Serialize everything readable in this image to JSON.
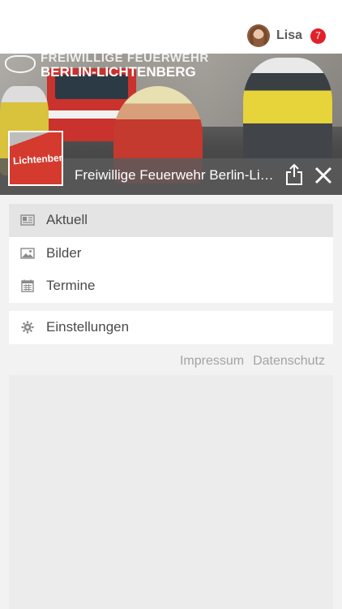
{
  "user": {
    "name": "Lisa",
    "notifications": "7"
  },
  "hero": {
    "logo_line1": "FREIWILLIGE FEUERWEHR",
    "logo_line2": "BERLIN-LICHTENBERG",
    "title": "Freiwillige Feuerwehr Berlin-Lichtenberg",
    "thumbnail_text": "Lichtenberg"
  },
  "menu": {
    "items": [
      {
        "label": "Aktuell",
        "icon": "newspaper-icon",
        "active": true
      },
      {
        "label": "Bilder",
        "icon": "image-icon",
        "active": false
      },
      {
        "label": "Termine",
        "icon": "calendar-icon",
        "active": false
      }
    ],
    "settings": {
      "label": "Einstellungen",
      "icon": "gear-icon"
    }
  },
  "footer_links": {
    "impressum": "Impressum",
    "datenschutz": "Datenschutz"
  },
  "colors": {
    "badge": "#e0212b",
    "active_item": "#e4e4e4",
    "text": "#4a4a4a",
    "link": "#a3a3a3"
  }
}
